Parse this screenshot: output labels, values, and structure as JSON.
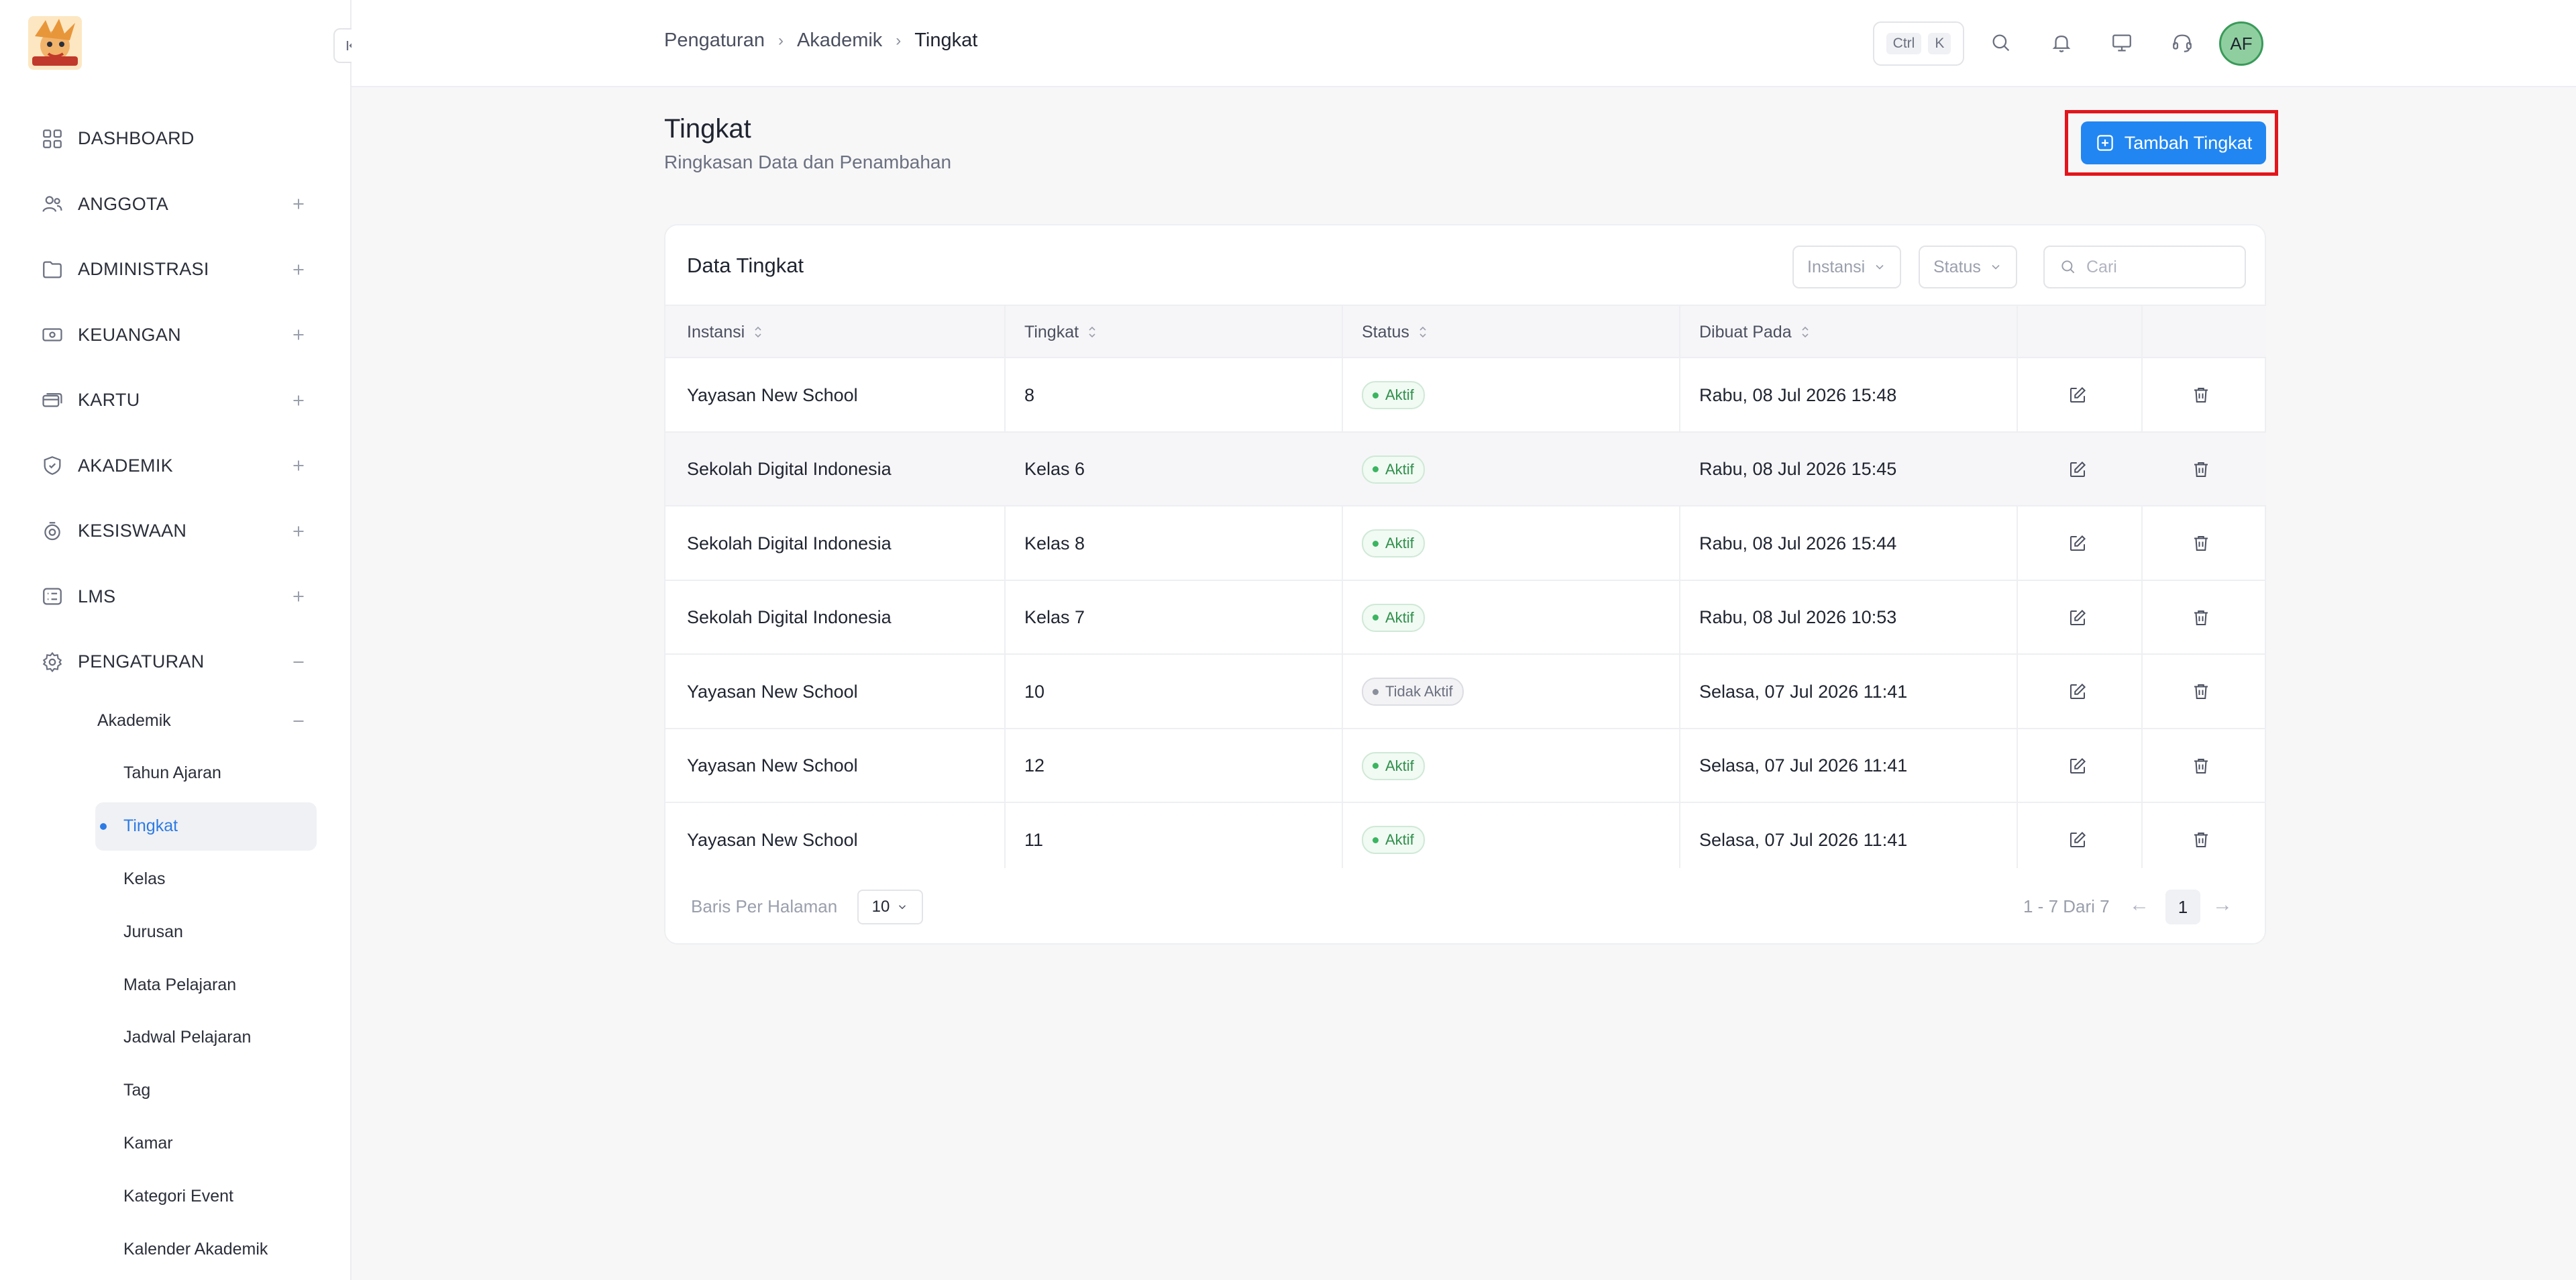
{
  "sidebar": {
    "items": [
      {
        "label": "DASHBOARD",
        "icon": "dashboard-icon",
        "expand": ""
      },
      {
        "label": "ANGGOTA",
        "icon": "users-icon",
        "expand": "+"
      },
      {
        "label": "ADMINISTRASI",
        "icon": "folder-icon",
        "expand": "+"
      },
      {
        "label": "KEUANGAN",
        "icon": "money-icon",
        "expand": "+"
      },
      {
        "label": "KARTU",
        "icon": "card-icon",
        "expand": "+"
      },
      {
        "label": "AKADEMIK",
        "icon": "shield-icon",
        "expand": "+"
      },
      {
        "label": "KESISWAAN",
        "icon": "badge-icon",
        "expand": "+"
      },
      {
        "label": "LMS",
        "icon": "list-icon",
        "expand": "+"
      },
      {
        "label": "PENGATURAN",
        "icon": "gear-icon",
        "expand": "−"
      }
    ],
    "sub_head": "Akademik",
    "sub_items": [
      "Tahun Ajaran",
      "Tingkat",
      "Kelas",
      "Jurusan",
      "Mata Pelajaran",
      "Jadwal Pelajaran",
      "Tag",
      "Kamar",
      "Kategori Event",
      "Kalender Akademik"
    ],
    "active_sub": "Tingkat"
  },
  "topbar": {
    "breadcrumb": [
      "Pengaturan",
      "Akademik",
      "Tingkat"
    ],
    "shortcut": [
      "Ctrl",
      "K"
    ],
    "avatar": "AF"
  },
  "page": {
    "title": "Tingkat",
    "subtitle": "Ringkasan Data dan Penambahan",
    "add_button": "Tambah Tingkat"
  },
  "table": {
    "title": "Data Tingkat",
    "filters": [
      "Instansi",
      "Status"
    ],
    "search_placeholder": "Cari",
    "headers": [
      "Instansi",
      "Tingkat",
      "Status",
      "Dibuat Pada"
    ],
    "rows": [
      {
        "instansi": "Yayasan New School",
        "tingkat": "8",
        "status": "Aktif",
        "dibuat": "Rabu, 08 Jul 2026 15:48"
      },
      {
        "instansi": "Sekolah Digital Indonesia",
        "tingkat": "Kelas 6",
        "status": "Aktif",
        "dibuat": "Rabu, 08 Jul 2026 15:45"
      },
      {
        "instansi": "Sekolah Digital Indonesia",
        "tingkat": "Kelas 8",
        "status": "Aktif",
        "dibuat": "Rabu, 08 Jul 2026 15:44"
      },
      {
        "instansi": "Sekolah Digital Indonesia",
        "tingkat": "Kelas 7",
        "status": "Aktif",
        "dibuat": "Rabu, 08 Jul 2026 10:53"
      },
      {
        "instansi": "Yayasan New School",
        "tingkat": "10",
        "status": "Tidak Aktif",
        "dibuat": "Selasa, 07 Jul 2026 11:41"
      },
      {
        "instansi": "Yayasan New School",
        "tingkat": "12",
        "status": "Aktif",
        "dibuat": "Selasa, 07 Jul 2026 11:41"
      },
      {
        "instansi": "Yayasan New School",
        "tingkat": "11",
        "status": "Aktif",
        "dibuat": "Selasa, 07 Jul 2026 11:41"
      }
    ],
    "per_page_label": "Baris Per Halaman",
    "per_page_value": "10",
    "range_text": "1 - 7 Dari 7",
    "current_page": "1",
    "prev_arrow": "←",
    "next_arrow": "→"
  },
  "colors": {
    "accent": "#2186f2",
    "active_status": "#2f8f4b",
    "inactive_status": "#6b7080",
    "highlight_frame": "#e3161b"
  }
}
